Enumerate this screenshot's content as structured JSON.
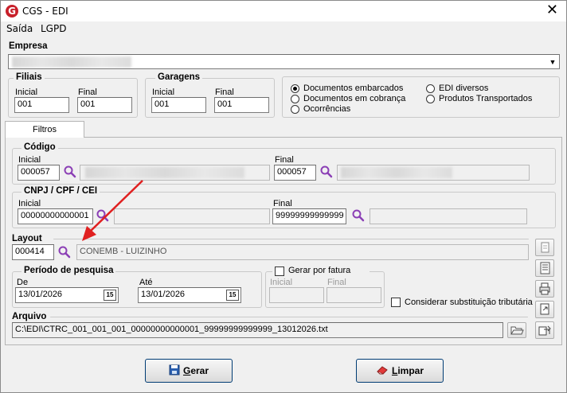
{
  "window": {
    "title": "CGS - EDI",
    "logo_letter": "G"
  },
  "menu": {
    "items": [
      "Saída",
      "LGPD"
    ]
  },
  "empresa": {
    "label": "Empresa"
  },
  "filiais": {
    "label": "Filiais",
    "inicial_label": "Inicial",
    "final_label": "Final",
    "inicial": "001",
    "final": "001"
  },
  "garagens": {
    "label": "Garagens",
    "inicial_label": "Inicial",
    "final_label": "Final",
    "inicial": "001",
    "final": "001"
  },
  "doc_options": {
    "items": [
      "Documentos embarcados",
      "Documentos em cobrança",
      "Ocorrências",
      "EDI diversos",
      "Produtos Transportados"
    ],
    "selected": "Documentos embarcados"
  },
  "tabs": {
    "filtros": "Filtros"
  },
  "codigo": {
    "label": "Código",
    "inicial_label": "Inicial",
    "final_label": "Final",
    "inicial": "000057",
    "final": "000057"
  },
  "cnpj": {
    "label": "CNPJ / CPF / CEI",
    "inicial_label": "Inicial",
    "final_label": "Final",
    "inicial": "00000000000001",
    "final": "99999999999999"
  },
  "layout": {
    "label": "Layout",
    "code": "000414",
    "description": "CONEMB - LUIZINHO"
  },
  "periodo": {
    "label": "Período de pesquisa",
    "de_label": "De",
    "ate_label": "Até",
    "de": "13/01/2026",
    "ate": "13/01/2026",
    "cal_icon_text": "15"
  },
  "fatura": {
    "label": "Gerar por fatura",
    "inicial_label": "Inicial",
    "final_label": "Final",
    "checked": false
  },
  "substituicao": {
    "label": "Considerar substituição tributária",
    "checked": false
  },
  "arquivo": {
    "label": "Arquivo",
    "path": "C:\\EDI\\CTRC_001_001_001_00000000000001_99999999999999_13012026.txt"
  },
  "buttons": {
    "gerar_first": "G",
    "gerar_rest": "erar",
    "limpar_first": "L",
    "limpar_rest": "impar"
  },
  "colors": {
    "accent_search": "#8b3fb5",
    "logo_red": "#c8202a",
    "arrow_red": "#e02020"
  }
}
